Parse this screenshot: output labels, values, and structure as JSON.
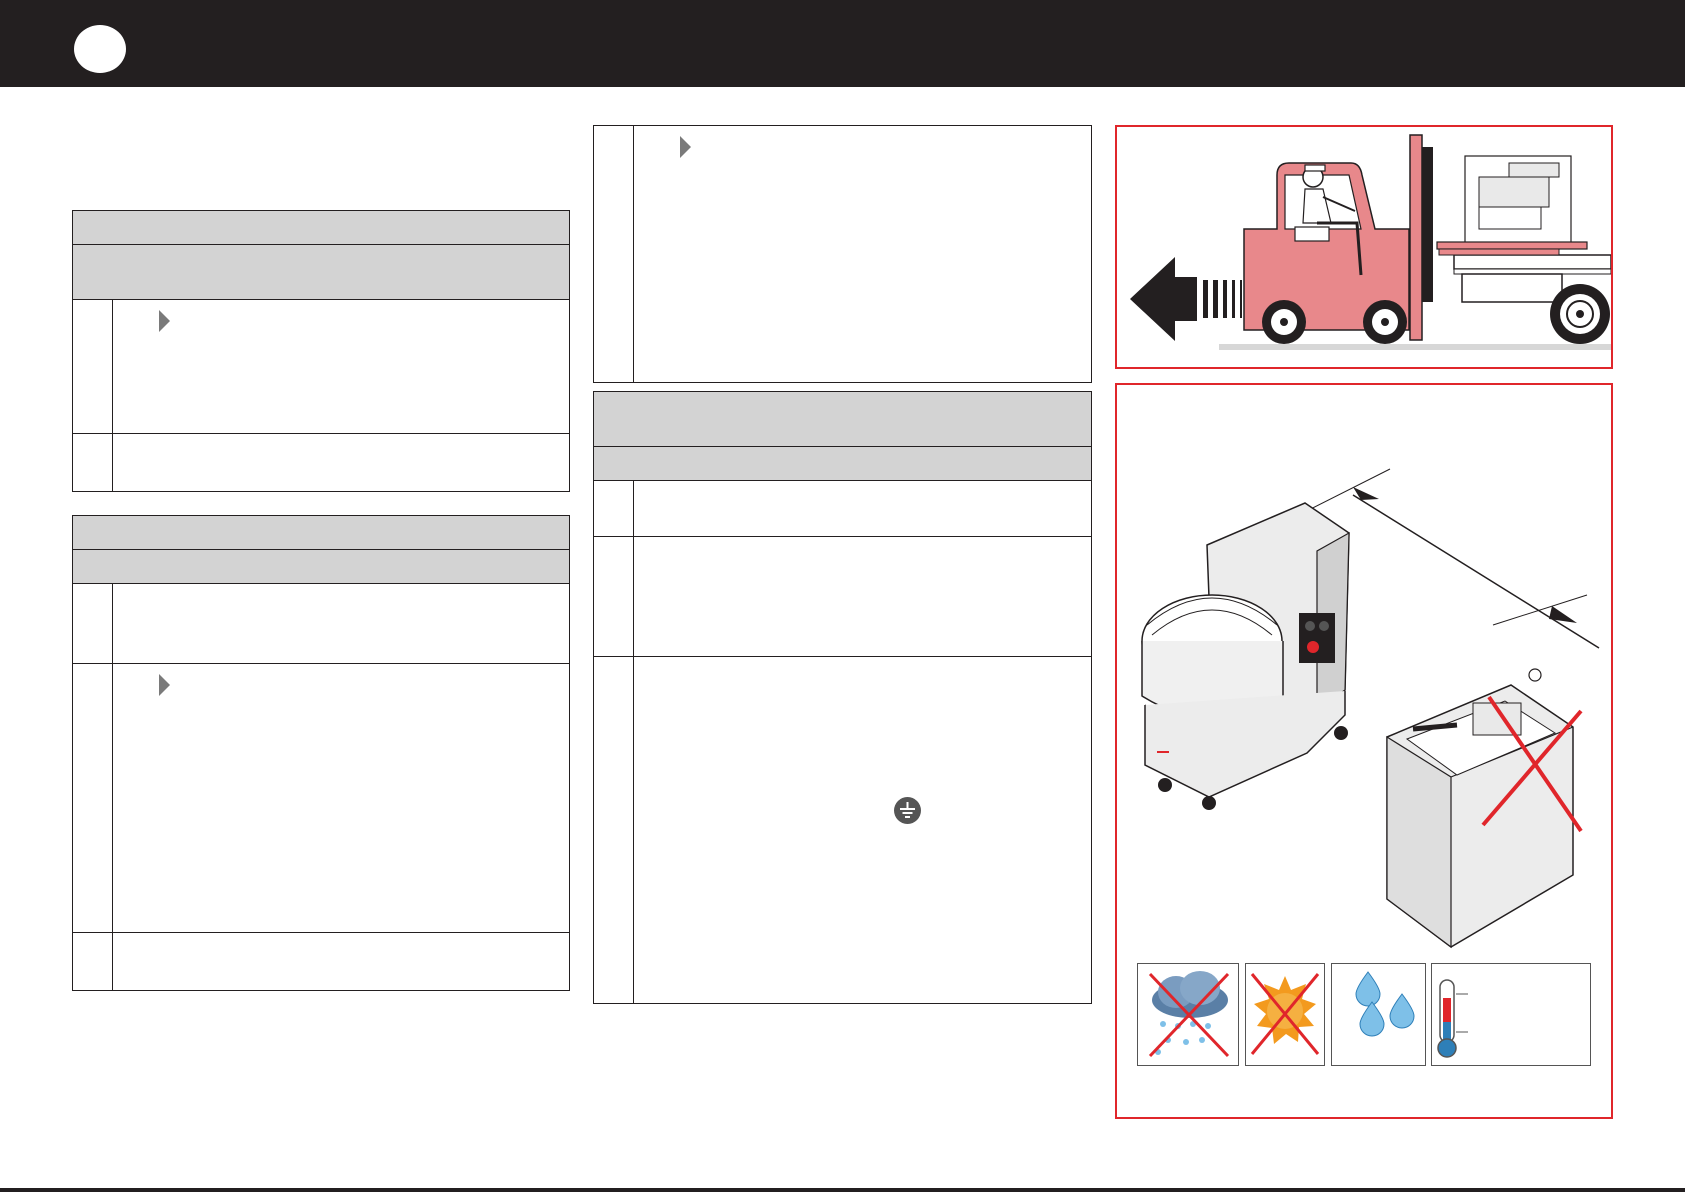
{
  "header": {
    "title": "",
    "badge": ""
  },
  "left_table_1": {
    "rows": 5
  },
  "left_table_2": {
    "rows": 5
  },
  "mid_table_1": {
    "rows": 1
  },
  "mid_table_2": {
    "rows": 5
  },
  "illustrations": {
    "forklift": "forklift-transport-illustration",
    "installation": "mixer-installation-distance-illustration",
    "conditions": [
      "no-rain-icon",
      "no-sun-icon",
      "humidity-icon",
      "temperature-icon"
    ]
  },
  "colors": {
    "header": "#231f20",
    "panel_border": "#e0262b",
    "forklift_body": "#e8888b",
    "row_grey": "#d3d3d3",
    "cross": "#e0262b"
  }
}
